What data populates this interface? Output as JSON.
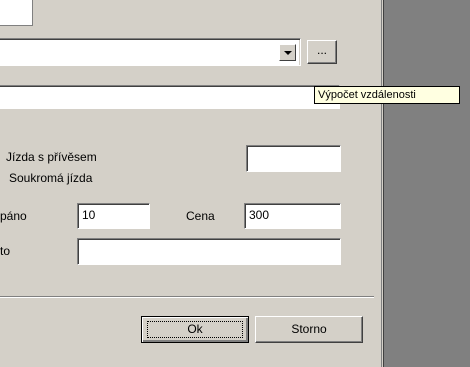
{
  "dialog": {
    "browse_button_label": "...",
    "tooltip": "Výpočet vzdálenosti",
    "checkbox_trailer": "Jízda s přívěsem",
    "checkbox_private": "Soukromá jízda",
    "paid_label": "páno",
    "paid_value": "10",
    "price_label": "Cena",
    "price_value": "300",
    "note_label": "to",
    "note_value": "",
    "trailer_value": "",
    "ok_label": "Ok",
    "cancel_label": "Storno"
  }
}
